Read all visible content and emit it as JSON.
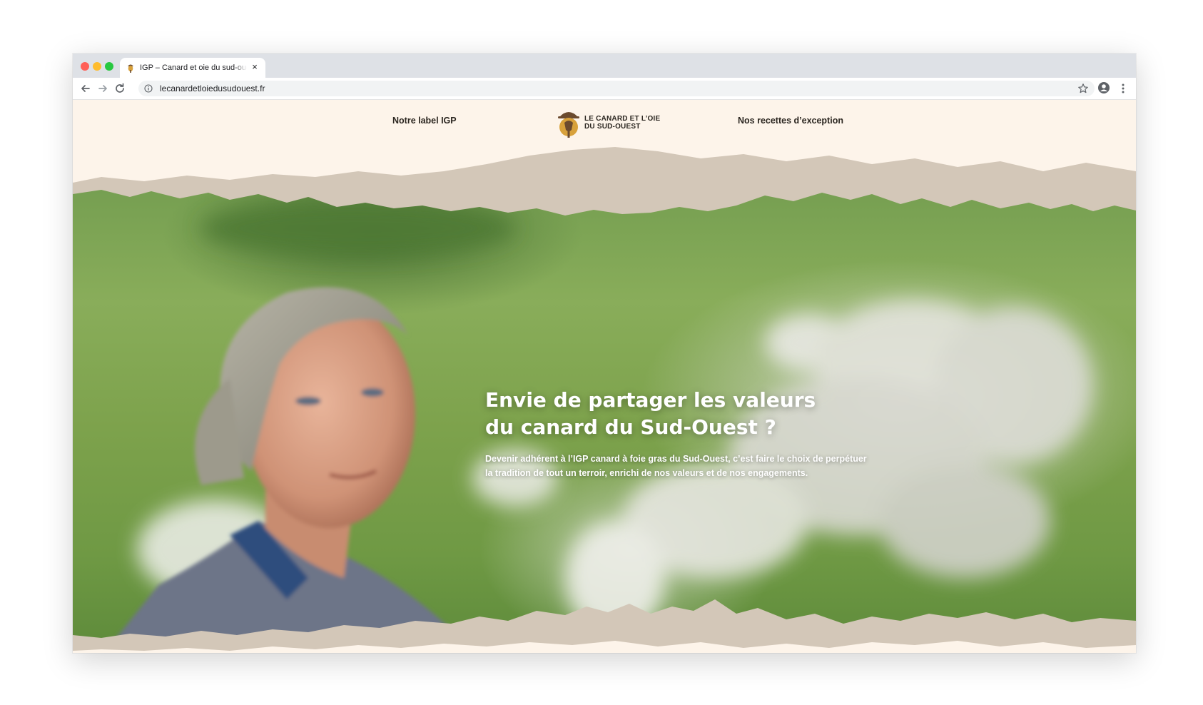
{
  "browser": {
    "tab": {
      "title": "IGP – Canard et oie du sud-ouest",
      "close_glyph": "×"
    },
    "url": "lecanardetloiedusudouest.fr",
    "icons": {
      "back": "arrow-left-icon",
      "forward": "arrow-right-icon",
      "reload": "reload-icon",
      "info": "info-icon",
      "bookmark": "star-icon",
      "profile": "profile-icon",
      "menu": "kebab-menu-icon"
    },
    "traffic_lights": {
      "close": "#ff5f57",
      "minimize": "#febc2e",
      "maximize": "#28c840"
    }
  },
  "header": {
    "nav_left": "Notre label IGP",
    "nav_right": "Nos recettes d’exception",
    "logo": {
      "line1": "LE CANARD ET L’OIE",
      "line2": "DU SUD-OUEST",
      "icon": "duck-farmer-logo-icon"
    }
  },
  "hero": {
    "title_line1": "Envie de partager les valeurs",
    "title_line2": "du canard du Sud-Ouest ?",
    "text_line1": "Devenir adhérent à l’IGP canard à foie gras du Sud-Ouest, c’est faire le choix de perpétuer",
    "text_line2": "la tradition de tout un terroir, enrichi de nos valeurs et de nos engagements."
  },
  "colors": {
    "page_background": "#fdf4ea",
    "paper_torn": "#d3c7b8",
    "text_dark": "#2b2620",
    "logo_brown": "#6b4a2e",
    "logo_gold": "#d8a13b"
  }
}
